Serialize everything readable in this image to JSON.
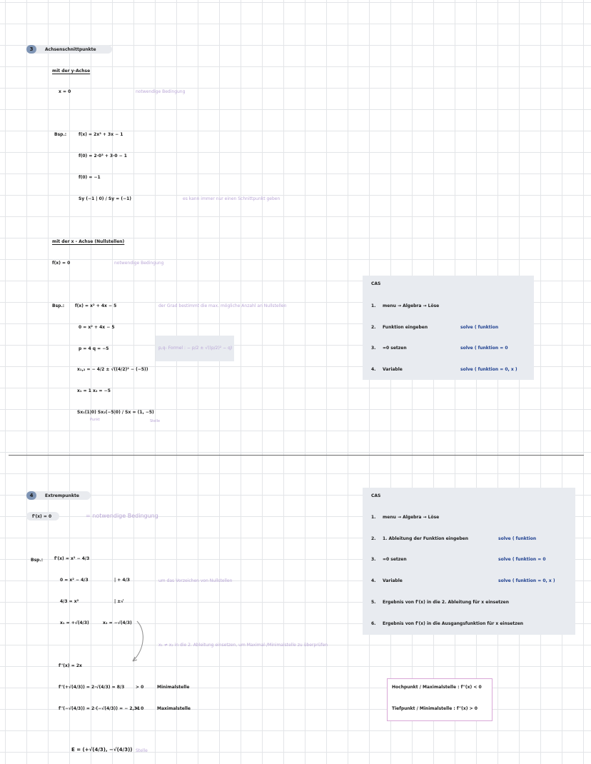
{
  "section3": {
    "number": "3",
    "title": "Achsenschnittpunkte",
    "y_axis": {
      "heading": "mit der y-Achse",
      "condition": "x = 0",
      "condition_note": "notwendige Bedingung",
      "example_label": "Bsp.:",
      "lines": [
        "f(x) = 2x³ + 3x − 1",
        "f(0) = 2·0³ + 3·0 − 1",
        "f(0) = −1",
        "Sy (−1 | 0)  /  Sy = (−1)"
      ],
      "note": "es kann immer nur einen Schnittpunkt geben"
    },
    "x_axis": {
      "heading": "mit der x - Achse (Nullstellen)",
      "condition": "f(x) = 0",
      "condition_note": "notwendige Bedingung",
      "example_label": "Bsp.:",
      "lines": [
        "f(x) = x² + 4x − 5",
        "0 = x² + 4x − 5",
        "p = 4    q = −5",
        "x₁,₂ = − 4/2 ± √((4/2)² − (−5))",
        "x₁ = 1    x₂ = −5",
        "Sx₁(1|0)  Sx₂(−5|0)  /  Sx = (1, −5)"
      ],
      "note_grad": "der Grad bestimmt die max. mögliche Anzahl an Nullstellen",
      "pq_formula": "p,q- Formel : − p/2 ± √((p/2)² − q)",
      "sub_punkt": "Punkt",
      "sub_stelle": "Stelle"
    },
    "cas": {
      "title": "CAS",
      "rows": [
        {
          "n": "1.",
          "text": "menu  →  Algebra  →  Löse",
          "right": ""
        },
        {
          "n": "2.",
          "text": "Funktion  eingeben",
          "right": "solve ( funktion"
        },
        {
          "n": "3.",
          "text": "=0  setzen",
          "right": "solve ( funktion = 0"
        },
        {
          "n": "4.",
          "text": "Variable",
          "right": "solve ( funktion = 0, x )"
        }
      ]
    }
  },
  "section4": {
    "number": "4",
    "title": "Extrempunkte",
    "condition": "f'(x) = 0",
    "condition_note": "= notwendige Bedingung",
    "example_label": "Bsp.:",
    "lines_left": [
      "f'(x) = x² − 4/3",
      "0 = x² − 4/3",
      "4/3 = x²",
      "x₁ = +√(4/3)"
    ],
    "lines_right": [
      "| + 4/3",
      "| ±√",
      "x₂ = −√(4/3)"
    ],
    "note_vorzeichen": "um das Vorzeichen von Nullstellen",
    "note_einsetzen": "x₁ ≠ x₂  in die 2. Ableitung einsetzen, um  Maximal-/Minimalstelle  zu überprüfen",
    "second": [
      {
        "expr": "f''(x) = 2x",
        "cmp": "",
        "label": ""
      },
      {
        "expr": "f''(+√(4/3)) = 2·√(4/3) = 8/3",
        "cmp": "> 0",
        "label": "Minimalstelle"
      },
      {
        "expr": "f''(−√(4/3)) = 2·(−√(4/3)) = − 2,31",
        "cmp": "< 0",
        "label": "Maximalstelle"
      }
    ],
    "result": "E = (+√(4/3), −√(4/3))",
    "result_note": "Stelle",
    "cas": {
      "title": "CAS",
      "rows": [
        {
          "n": "1.",
          "text": "menu  →  Algebra  →  Löse",
          "right": ""
        },
        {
          "n": "2.",
          "text": "1. Ableitung  der  Funktion  eingeben",
          "right": "solve ( funktion"
        },
        {
          "n": "3.",
          "text": "=0  setzen",
          "right": "solve ( funktion = 0"
        },
        {
          "n": "4.",
          "text": "Variable",
          "right": "solve ( funktion = 0, x )"
        },
        {
          "n": "5.",
          "text": "Ergebnis  von  f'(x)  in  die  2. Ableitung  für  x  einsetzen",
          "right": ""
        },
        {
          "n": "6.",
          "text": "Ergebnis  von  f'(x)  in  die  Ausgangsfunktion  für  x  einsetzen",
          "right": ""
        }
      ]
    },
    "summary": [
      "Hochpunkt / Maximalstelle :  f''(x) < 0",
      "Tiefpunkt / Minimalstelle :  f''(x) > 0"
    ]
  }
}
